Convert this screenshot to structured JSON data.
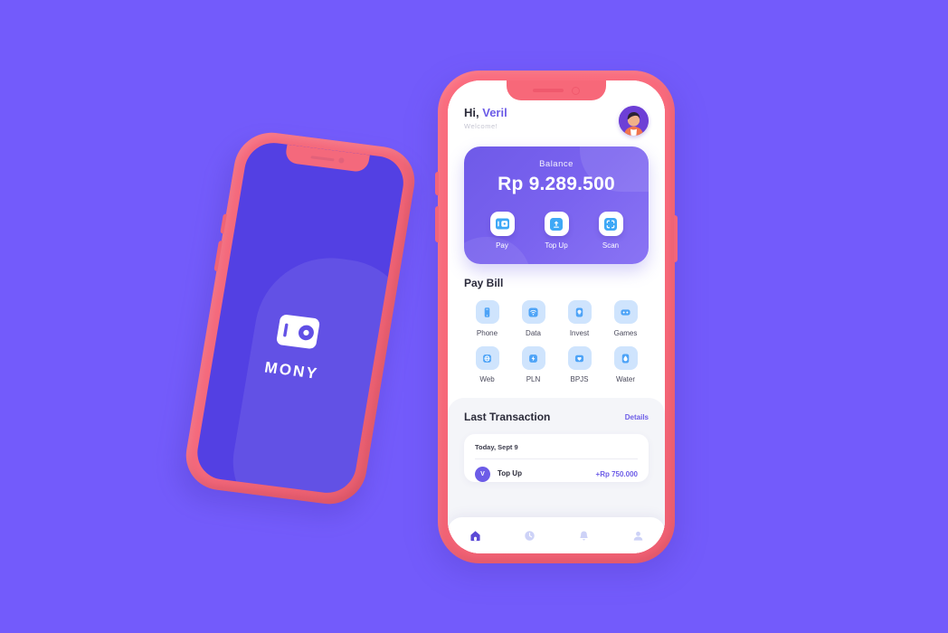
{
  "background_color": "#735bfb",
  "frame_color": "#f76879",
  "accent_color": "#6c5ce7",
  "splash_phone": {
    "brand": "MONY",
    "logo_icon": "wallet-icon",
    "screen_color": "#5340e3"
  },
  "app": {
    "header": {
      "greeting_prefix": "Hi,",
      "user_name": "Veril",
      "subtitle": "Welcome!",
      "avatar_icon": "avatar"
    },
    "balance_card": {
      "label": "Balance",
      "amount": "Rp 9.289.500",
      "actions": [
        {
          "label": "Pay",
          "icon": "wallet-icon"
        },
        {
          "label": "Top Up",
          "icon": "card-up-icon"
        },
        {
          "label": "Scan",
          "icon": "qr-scan-icon"
        }
      ]
    },
    "pay_bill": {
      "title": "Pay Bill",
      "items": [
        {
          "label": "Phone",
          "icon": "mobile-icon"
        },
        {
          "label": "Data",
          "icon": "wifi-icon"
        },
        {
          "label": "Invest",
          "icon": "lightbulb-icon"
        },
        {
          "label": "Games",
          "icon": "gamepad-icon"
        },
        {
          "label": "Web",
          "icon": "globe-icon"
        },
        {
          "label": "PLN",
          "icon": "bolt-icon"
        },
        {
          "label": "BPJS",
          "icon": "heart-shield-icon"
        },
        {
          "label": "Water",
          "icon": "droplet-icon"
        }
      ]
    },
    "last_transaction": {
      "title": "Last Transaction",
      "details_label": "Details",
      "date_group": "Today, Sept 9",
      "rows": [
        {
          "title": "Top Up",
          "subtitle": "",
          "amount": "+Rp 750.000",
          "avatar_letter": "V"
        }
      ]
    },
    "bottom_nav": [
      {
        "icon": "home-icon",
        "active": true
      },
      {
        "icon": "clock-icon",
        "active": false
      },
      {
        "icon": "bell-icon",
        "active": false
      },
      {
        "icon": "person-icon",
        "active": false
      }
    ]
  }
}
